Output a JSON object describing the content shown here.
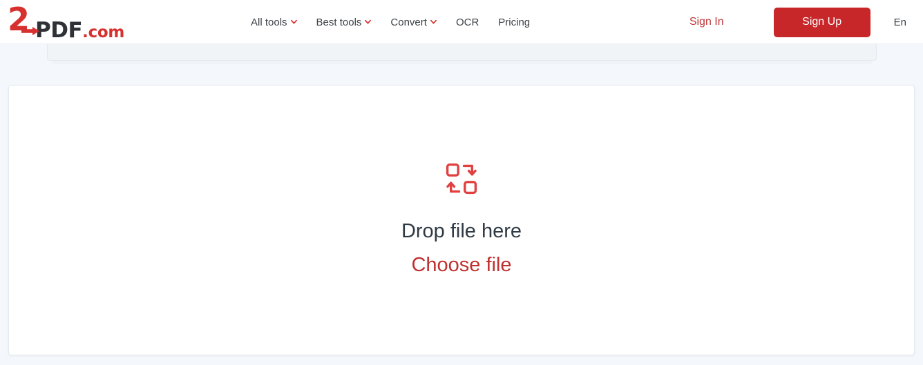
{
  "brand": {
    "logo_digit": "2",
    "logo_main": "PDF",
    "logo_tld": ".com",
    "accent_red": "#c8272a",
    "icon_red": "#e0403f",
    "link_red": "#c0302f",
    "dark_text": "#2f3a45",
    "page_bg": "#f4f7fb"
  },
  "nav": {
    "items": [
      {
        "label": "All tools",
        "has_caret": true
      },
      {
        "label": "Best tools",
        "has_caret": true
      },
      {
        "label": "Convert",
        "has_caret": true
      },
      {
        "label": "OCR",
        "has_caret": false
      },
      {
        "label": "Pricing",
        "has_caret": false
      }
    ]
  },
  "header_actions": {
    "sign_in_label": "Sign In",
    "sign_up_label": "Sign Up",
    "language_label": "En"
  },
  "dropzone": {
    "icon_name": "convert-files-icon",
    "title": "Drop file here",
    "choose_file_label": "Choose file"
  }
}
